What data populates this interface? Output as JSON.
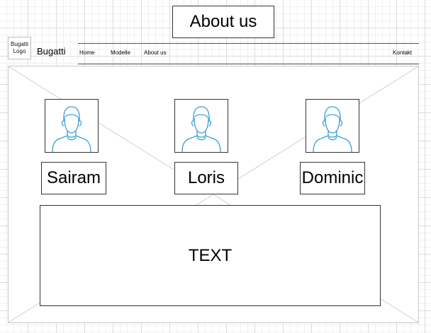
{
  "header": {
    "title": "About us",
    "logo_text": "Bugatti Logo",
    "brand": "Bugatti"
  },
  "nav": {
    "items": [
      {
        "label": "Home"
      },
      {
        "label": "Modelle"
      },
      {
        "label": "About us"
      },
      {
        "label": "Kontakt"
      }
    ]
  },
  "team": {
    "members": [
      {
        "name": "Sairam",
        "avatar_icon": "user-avatar-icon"
      },
      {
        "name": "Loris",
        "avatar_icon": "user-avatar-icon"
      },
      {
        "name": "Dominic",
        "avatar_icon": "user-avatar-icon"
      }
    ]
  },
  "content": {
    "text": "TEXT"
  },
  "colors": {
    "avatar_stroke": "#3a9fd6",
    "border": "#333333",
    "placeholder_lines": "#d0d0d0"
  }
}
